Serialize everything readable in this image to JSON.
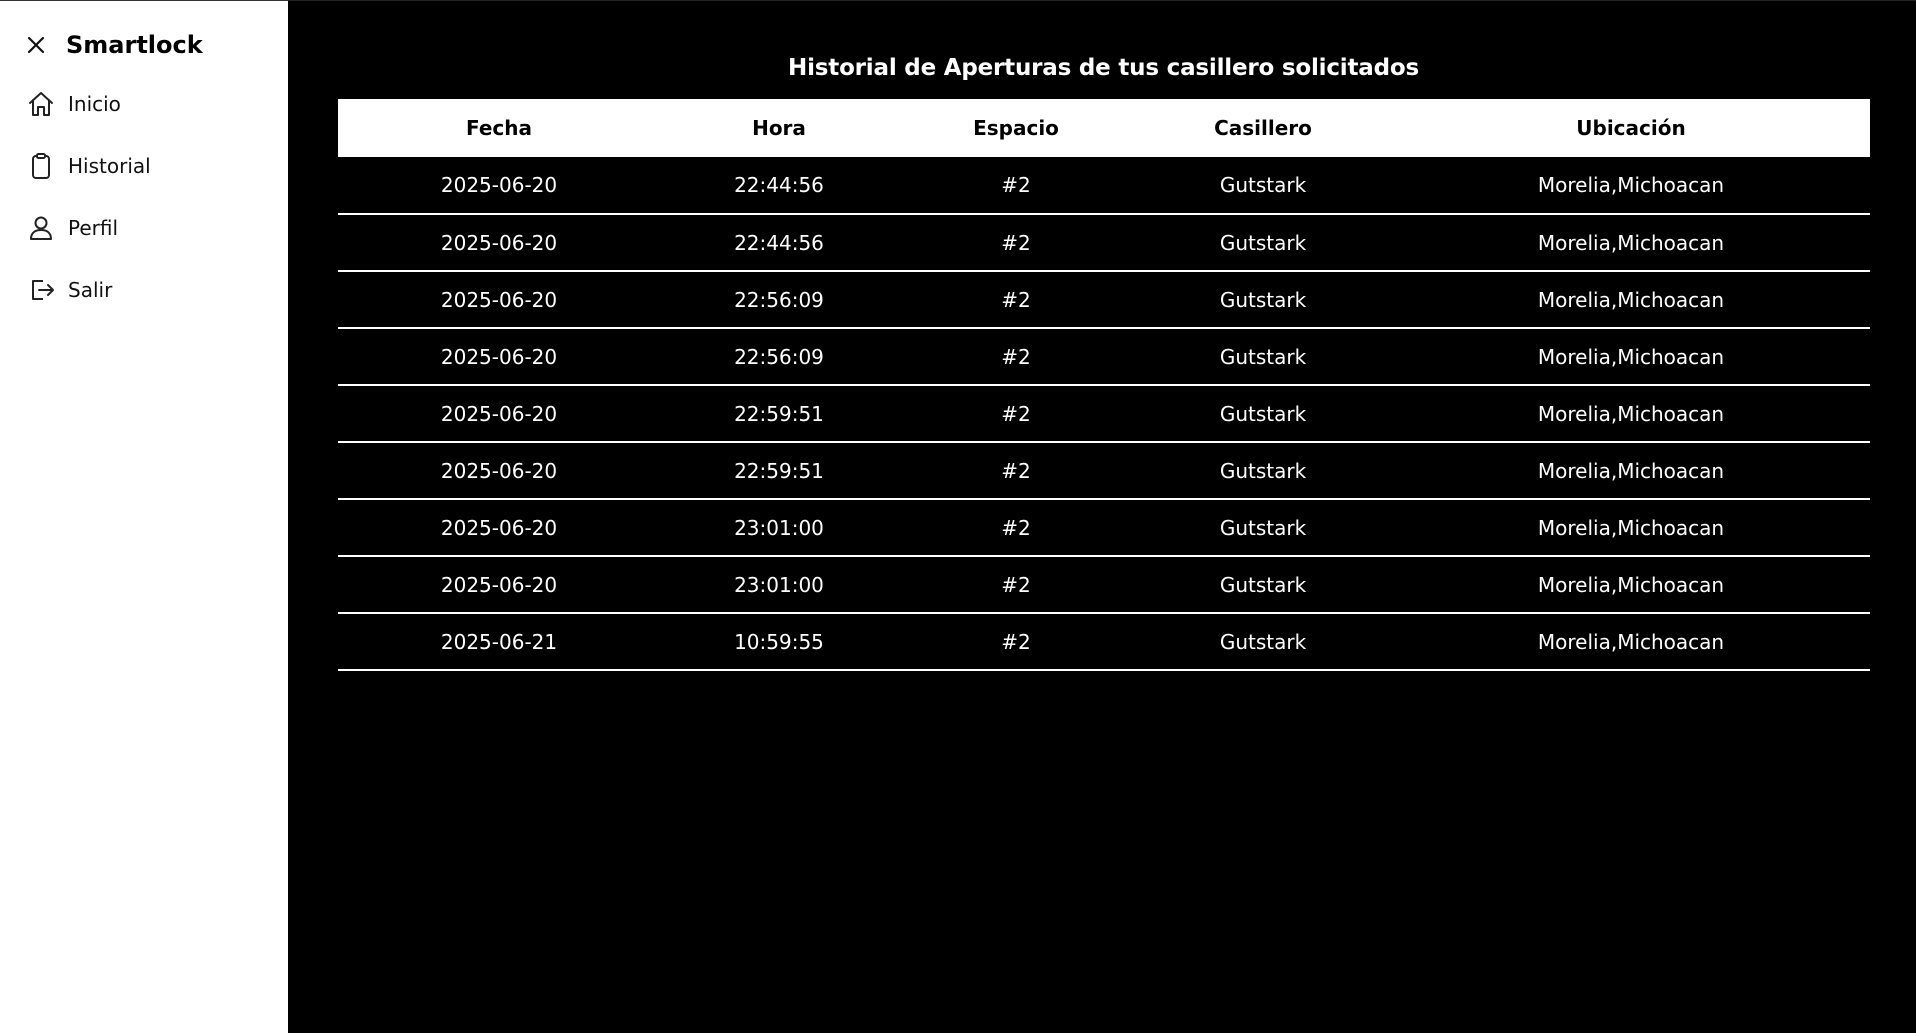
{
  "sidebar": {
    "brand": "Smartlock",
    "items": [
      {
        "label": "Inicio",
        "icon": "home-icon"
      },
      {
        "label": "Historial",
        "icon": "clipboard-icon"
      },
      {
        "label": "Perfil",
        "icon": "user-icon"
      },
      {
        "label": "Salir",
        "icon": "logout-icon"
      }
    ]
  },
  "main": {
    "title": "Historial de Aperturas de tus casillero solicitados",
    "table": {
      "headers": [
        "Fecha",
        "Hora",
        "Espacio",
        "Casillero",
        "Ubicación"
      ],
      "rows": [
        [
          "2025-06-20",
          "22:44:56",
          "#2",
          "Gutstark",
          "Morelia,Michoacan"
        ],
        [
          "2025-06-20",
          "22:44:56",
          "#2",
          "Gutstark",
          "Morelia,Michoacan"
        ],
        [
          "2025-06-20",
          "22:56:09",
          "#2",
          "Gutstark",
          "Morelia,Michoacan"
        ],
        [
          "2025-06-20",
          "22:56:09",
          "#2",
          "Gutstark",
          "Morelia,Michoacan"
        ],
        [
          "2025-06-20",
          "22:59:51",
          "#2",
          "Gutstark",
          "Morelia,Michoacan"
        ],
        [
          "2025-06-20",
          "22:59:51",
          "#2",
          "Gutstark",
          "Morelia,Michoacan"
        ],
        [
          "2025-06-20",
          "23:01:00",
          "#2",
          "Gutstark",
          "Morelia,Michoacan"
        ],
        [
          "2025-06-20",
          "23:01:00",
          "#2",
          "Gutstark",
          "Morelia,Michoacan"
        ],
        [
          "2025-06-21",
          "10:59:55",
          "#2",
          "Gutstark",
          "Morelia,Michoacan"
        ]
      ]
    }
  },
  "colors": {
    "sidebar_bg": "#ffffff",
    "main_bg": "#000000",
    "text_light": "#ffffff"
  }
}
